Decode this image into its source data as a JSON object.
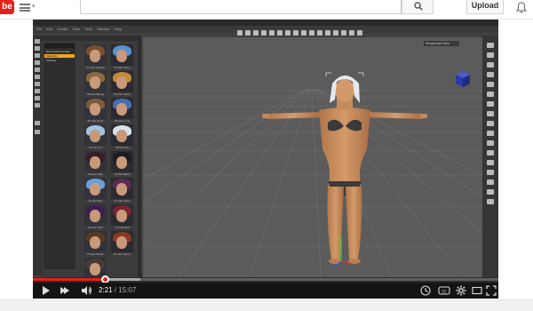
{
  "header": {
    "logo_text": "be",
    "search_placeholder": "",
    "upload_label": "Upload"
  },
  "app": {
    "menu": [
      "File",
      "Edit",
      "Create",
      "View",
      "Tools",
      "Window",
      "Help"
    ],
    "content_tree": [
      "Daz Studio Formats",
      "Materials",
      "Clothing"
    ],
    "viewport_label": "Perspective View"
  },
  "thumbnails": [
    {
      "label": "01 Hair Straight",
      "hair": "#7b4f2b"
    },
    {
      "label": "02 Hair Wavy",
      "hair": "#5a8fd0"
    },
    {
      "label": "03 Hair Bangs",
      "hair": "#8c6a3c"
    },
    {
      "label": "04 Hair Sides",
      "hair": "#c48a3a"
    },
    {
      "label": "05 Hair Short",
      "hair": "#7c5b3a"
    },
    {
      "label": "06 Hair Long",
      "hair": "#4a6fb0"
    },
    {
      "label": "07 Hair Ice",
      "hair": "#9fc3e4"
    },
    {
      "label": "08 Hair Mix",
      "hair": "#d7e2ea"
    },
    {
      "label": "09 Hair Dark",
      "hair": "#3a1e2a"
    },
    {
      "label": "10 Hair Black",
      "hair": "#1c1c22"
    },
    {
      "label": "11 Hair Blue",
      "hair": "#6b9fd8"
    },
    {
      "label": "12 Hair Violet",
      "hair": "#5c2a52"
    },
    {
      "label": "13 Hair Plum",
      "hair": "#3d1f55"
    },
    {
      "label": "14 Hair Red",
      "hair": "#7a2430"
    },
    {
      "label": "15 Hair Brown",
      "hair": "#5b3a24"
    },
    {
      "label": "16 Hair Auburn",
      "hair": "#8a3a22"
    },
    {
      "label": "17 Hair Mix",
      "hair": "#4a3a36"
    }
  ],
  "player": {
    "current_time": "2:21",
    "separator": " / ",
    "duration": "15:07",
    "played_fraction": 0.155,
    "loaded_fraction": 0.23,
    "quality_badge": "HD"
  },
  "colors": {
    "brand": "#e62117",
    "tree_selected": "#f2a51a",
    "viewport_bg": "#5b5b5b"
  }
}
